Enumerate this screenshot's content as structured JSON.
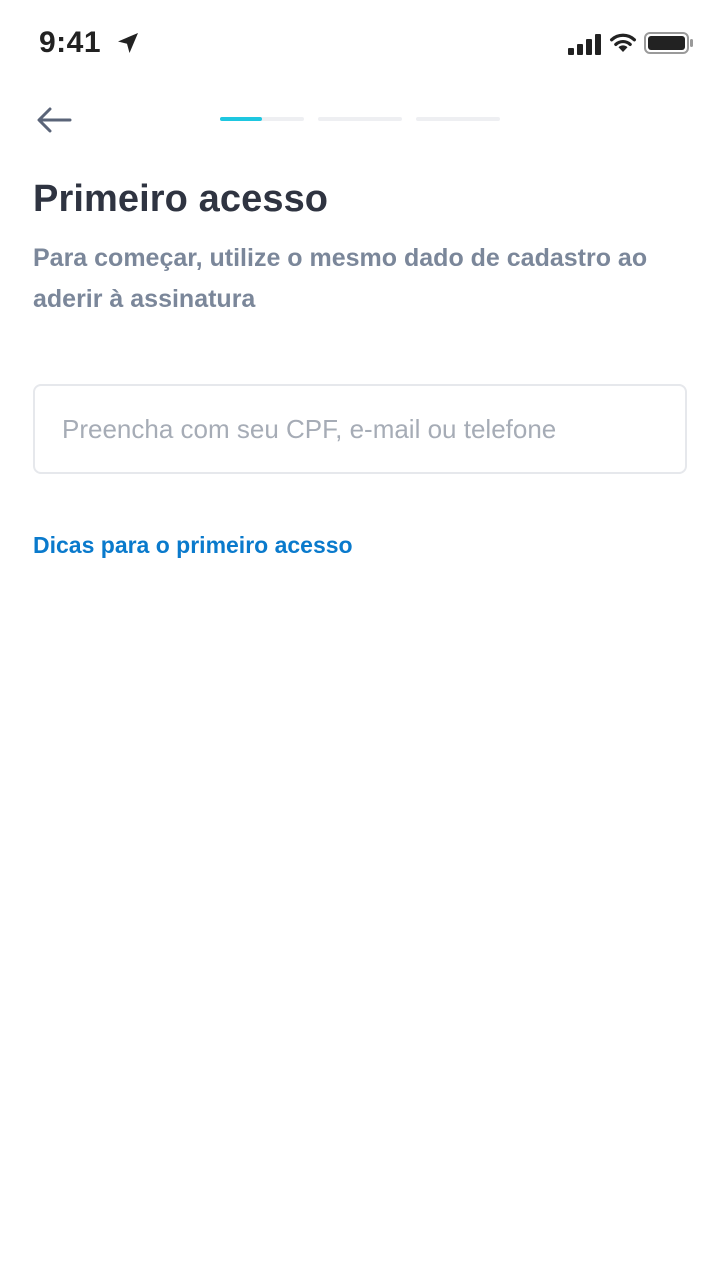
{
  "status_bar": {
    "time": "9:41",
    "icons": [
      "location-arrow-icon",
      "signal-bars-icon",
      "wifi-icon",
      "battery-icon"
    ]
  },
  "header": {
    "back_icon": "arrow-left-icon",
    "progress": {
      "current_step": 1,
      "total_steps": 3,
      "current_step_fill": 0.5
    }
  },
  "page": {
    "title": "Primeiro acesso",
    "subtitle": "Para começar, utilize o mesmo dado de cadastro ao aderir à assinatura"
  },
  "identifier_field": {
    "value": "",
    "placeholder": "Preencha com seu CPF, e-mail ou telefone"
  },
  "tips_link": {
    "label": "Dicas para o primeiro acesso"
  },
  "colors": {
    "title": "#2f3441",
    "subtitle": "#7b879a",
    "link": "#0a7acc",
    "progress_active": "#1ec7e0",
    "progress_inactive": "#eeeff2",
    "field_border": "#e6e8ec",
    "placeholder": "#a6acb6"
  }
}
